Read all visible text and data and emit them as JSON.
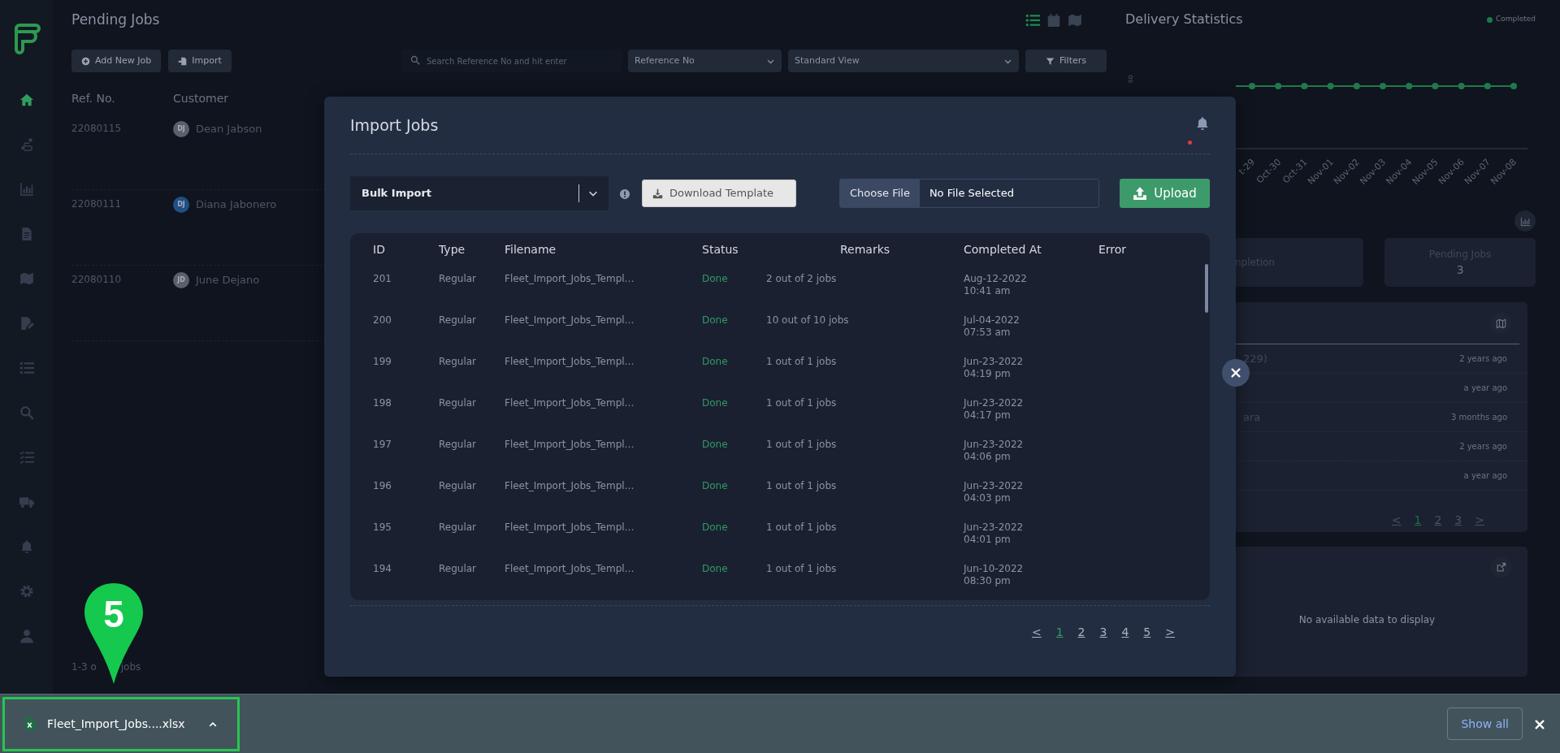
{
  "sidebar": {
    "items": [
      {
        "kind": "home",
        "selected": true
      },
      {
        "kind": "route",
        "selected": false
      },
      {
        "kind": "chart",
        "selected": false
      },
      {
        "kind": "doc",
        "selected": false
      },
      {
        "kind": "map",
        "selected": false
      },
      {
        "kind": "edit",
        "selected": false
      },
      {
        "kind": "list",
        "selected": false
      },
      {
        "kind": "search",
        "selected": false
      },
      {
        "kind": "tasks",
        "selected": false
      },
      {
        "kind": "truck",
        "selected": false
      },
      {
        "kind": "bell",
        "selected": false
      },
      {
        "kind": "gear",
        "selected": false
      },
      {
        "kind": "user",
        "selected": false
      }
    ]
  },
  "pending_jobs": {
    "title": "Pending Jobs",
    "view_toggles": [
      {
        "kind": "list",
        "selected": true
      },
      {
        "kind": "calendar",
        "selected": false
      },
      {
        "kind": "map",
        "selected": false
      }
    ],
    "buttons": [
      {
        "kind": "add",
        "label": "Add New Job"
      },
      {
        "kind": "import",
        "label": "Import"
      }
    ],
    "search": {
      "placeholder": "Search Reference No and hit enter"
    },
    "search_by": "Reference No",
    "view": "Standard View",
    "filters_button": "Filters",
    "columns": [
      "Ref. No.",
      "Customer"
    ],
    "rows": [
      {
        "ref": "22080115",
        "initials": "DJ",
        "customer": "Dean Jabson",
        "color": "#5a606b"
      },
      {
        "ref": "22080111",
        "initials": "DJ",
        "customer": "Diana Jabonero",
        "color": "#1f4f86"
      },
      {
        "ref": "22080110",
        "initials": "JD",
        "customer": "June Dejano",
        "color": "#5a606b"
      }
    ],
    "footer": [
      "1-3 o",
      "jobs"
    ]
  },
  "delivery_statistics": {
    "title": "Delivery Statistics",
    "legend": [
      {
        "label": "Completed",
        "color": "#1f7a4b"
      }
    ],
    "y_axis_label": "os",
    "x_labels": [
      "t-29",
      "Oct-30",
      "Oct-31",
      "Nov-01",
      "Nov-02",
      "Nov-03",
      "Nov-04",
      "Nov-05",
      "Nov-06",
      "Nov-07",
      "Nov-08"
    ]
  },
  "stats": [
    {
      "label": "npletion"
    },
    {
      "label": "Pending Jobs",
      "value": "3"
    }
  ],
  "recent": {
    "items": [
      {
        "title": "229)",
        "time": "2 years ago"
      },
      {
        "time": "a year ago"
      },
      {
        "title": "ara",
        "time": "3 months ago"
      },
      {
        "time": "2 years ago"
      },
      {
        "time": "a year ago"
      }
    ],
    "pagination": [
      {
        "label": "<",
        "selected": false
      },
      {
        "label": "1",
        "selected": true
      },
      {
        "label": "2",
        "selected": false
      },
      {
        "label": "3",
        "selected": false
      },
      {
        "label": ">",
        "selected": false
      }
    ]
  },
  "map_panel": {
    "message": "No available data to display"
  },
  "modal": {
    "title": "Import Jobs",
    "notification_unread": true,
    "import_type": "Bulk Import",
    "download_template": "Download Template",
    "file": {
      "button": "Choose File",
      "value": "No File Selected"
    },
    "upload": "Upload",
    "columns": [
      "ID",
      "Type",
      "Filename",
      "Status",
      "Remarks",
      "Completed At",
      "Error"
    ],
    "rows": [
      {
        "id": "201",
        "type": "Regular",
        "filename": "Fleet_Import_Jobs_Templ…",
        "status": "Done",
        "remarks": "2 out of 2 jobs",
        "date": "Aug-12-2022",
        "time": "10:41 am"
      },
      {
        "id": "200",
        "type": "Regular",
        "filename": "Fleet_Import_Jobs_Templ…",
        "status": "Done",
        "remarks": "10 out of 10 jobs",
        "date": "Jul-04-2022",
        "time": "07:53 am"
      },
      {
        "id": "199",
        "type": "Regular",
        "filename": "Fleet_Import_Jobs_Templ…",
        "status": "Done",
        "remarks": "1 out of 1 jobs",
        "date": "Jun-23-2022",
        "time": "04:19 pm"
      },
      {
        "id": "198",
        "type": "Regular",
        "filename": "Fleet_Import_Jobs_Templ…",
        "status": "Done",
        "remarks": "1 out of 1 jobs",
        "date": "Jun-23-2022",
        "time": "04:17 pm"
      },
      {
        "id": "197",
        "type": "Regular",
        "filename": "Fleet_Import_Jobs_Templ…",
        "status": "Done",
        "remarks": "1 out of 1 jobs",
        "date": "Jun-23-2022",
        "time": "04:06 pm"
      },
      {
        "id": "196",
        "type": "Regular",
        "filename": "Fleet_Import_Jobs_Templ…",
        "status": "Done",
        "remarks": "1 out of 1 jobs",
        "date": "Jun-23-2022",
        "time": "04:03 pm"
      },
      {
        "id": "195",
        "type": "Regular",
        "filename": "Fleet_Import_Jobs_Templ…",
        "status": "Done",
        "remarks": "1 out of 1 jobs",
        "date": "Jun-23-2022",
        "time": "04:01 pm"
      },
      {
        "id": "194",
        "type": "Regular",
        "filename": "Fleet_Import_Jobs_Templ…",
        "status": "Done",
        "remarks": "1 out of 1 jobs",
        "date": "Jun-10-2022",
        "time": "08:30 pm"
      }
    ],
    "pagination": [
      {
        "label": "<",
        "selected": false
      },
      {
        "label": "1",
        "selected": true
      },
      {
        "label": "2",
        "selected": false
      },
      {
        "label": "3",
        "selected": false
      },
      {
        "label": "4",
        "selected": false
      },
      {
        "label": "5",
        "selected": false
      },
      {
        "label": ">",
        "selected": false
      }
    ]
  },
  "download_bar": {
    "file": "Fleet_Import_Jobs....xlsx",
    "highlighted": true,
    "show_all": "Show all"
  },
  "callout": {
    "label": "5"
  }
}
